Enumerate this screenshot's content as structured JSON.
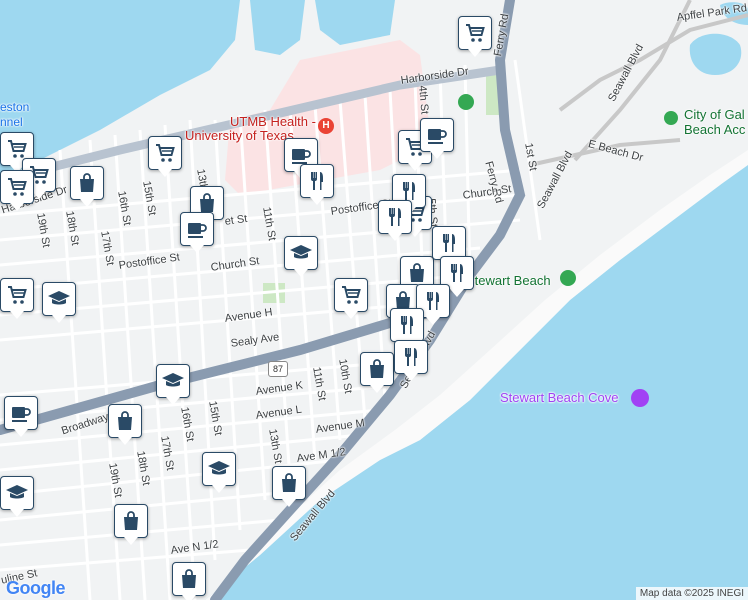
{
  "map": {
    "places": {
      "utmb_line1": "UTMB Health -",
      "utmb_line2": "University of Texas",
      "city_line1": "City of Gal",
      "city_line2": "Beach Acc",
      "stewart_beach": "Stewart Beach",
      "stewart_beach_cove": "Stewart Beach Cove",
      "harbor_partial_1": "eston",
      "harbor_partial_2": "nnel"
    },
    "streets": {
      "harborside_dr": "Harborside Dr",
      "harborside_dr_left": "Harborside Dr",
      "ferry_rd": "Ferry Rd",
      "apffel_park_rd": "Apffel Park Rd",
      "seawall_blvd_ne": "Seawall Blvd",
      "seawall_blvd_mid": "Seawall Blvd",
      "seawall_blvd_sw": "Seawall Blvd",
      "seawall_blvd_bottom": "Seawall Blvd",
      "e_beach_dr": "E Beach Dr",
      "first_st": "1st St",
      "fourth_st": "4th St",
      "fifth_st": "5th St",
      "church_st_e": "Church St",
      "church_st_w": "Church St",
      "postoffice_st_e": "Postoffice St",
      "postoffice_st_w": "Postoffice St",
      "market_st": "et St",
      "avenue_h": "Avenue H",
      "sealy_ave": "Sealy Ave",
      "broadway": "Broadway",
      "avenue_k": "Avenue K",
      "avenue_l": "Avenue L",
      "avenue_m": "Avenue M",
      "ave_m_half": "Ave M 1/2",
      "ave_n_half": "Ave N 1/2",
      "pauline_st": "uline St",
      "tenth_st": "10th St",
      "eleventh_st": "11th St",
      "eleventh_st_s": "11th St",
      "thirteenth_st": "13th St",
      "thirteenth_st_n": "13th",
      "fifteenth_st": "15th St",
      "fifteenth_st_n": "15th St",
      "sixteenth_st": "16th St",
      "sixteenth_st_s": "16th St",
      "seventeenth_st": "17th St",
      "seventeenth_st_s": "17th St",
      "eighteenth_st": "18th St",
      "eighteenth_st_s": "18th St",
      "nineteenth_st": "19th St",
      "nineteenth_st_s": "19th St",
      "highway_87": "87"
    },
    "markers": [
      {
        "type": "shopping-cart",
        "label": "shopping"
      },
      {
        "type": "shopping-cart",
        "label": "shopping"
      },
      {
        "type": "shopping-cart",
        "label": "shopping"
      },
      {
        "type": "shopping-cart",
        "label": "shopping"
      },
      {
        "type": "shopping-cart",
        "label": "shopping"
      },
      {
        "type": "shopping-cart",
        "label": "shopping"
      },
      {
        "type": "shopping-cart",
        "label": "shopping"
      },
      {
        "type": "shopping-cart",
        "label": "shopping"
      },
      {
        "type": "shopping-cart",
        "label": "shopping"
      },
      {
        "type": "shopping-bag",
        "label": "store"
      },
      {
        "type": "shopping-bag",
        "label": "store"
      },
      {
        "type": "shopping-bag",
        "label": "store"
      },
      {
        "type": "shopping-bag",
        "label": "store"
      },
      {
        "type": "shopping-bag",
        "label": "store"
      },
      {
        "type": "shopping-bag",
        "label": "store"
      },
      {
        "type": "shopping-bag",
        "label": "store"
      },
      {
        "type": "shopping-bag",
        "label": "store"
      },
      {
        "type": "shopping-bag",
        "label": "store"
      },
      {
        "type": "coffee-cup",
        "label": "cafe"
      },
      {
        "type": "coffee-cup",
        "label": "cafe"
      },
      {
        "type": "coffee-cup",
        "label": "cafe"
      },
      {
        "type": "coffee-cup",
        "label": "cafe"
      },
      {
        "type": "fork-knife",
        "label": "restaurant"
      },
      {
        "type": "fork-knife",
        "label": "restaurant"
      },
      {
        "type": "fork-knife",
        "label": "restaurant"
      },
      {
        "type": "fork-knife",
        "label": "restaurant"
      },
      {
        "type": "fork-knife",
        "label": "restaurant"
      },
      {
        "type": "fork-knife",
        "label": "restaurant"
      },
      {
        "type": "fork-knife",
        "label": "restaurant"
      },
      {
        "type": "fork-knife",
        "label": "restaurant"
      },
      {
        "type": "graduation-cap",
        "label": "school"
      },
      {
        "type": "graduation-cap",
        "label": "school"
      },
      {
        "type": "graduation-cap",
        "label": "school"
      },
      {
        "type": "graduation-cap",
        "label": "school"
      },
      {
        "type": "graduation-cap",
        "label": "school"
      }
    ],
    "colors": {
      "water": "#9ed8f0",
      "land": "#f1f3f4",
      "road_major": "#8a9bb0",
      "hospital_area": "#fbe3e4",
      "park": "#cde8c4",
      "pin_border": "#2a4a66",
      "pin_icon": "#2a4a66"
    },
    "attribution": "Map data ©2025 INEGI",
    "logo": "Google"
  }
}
